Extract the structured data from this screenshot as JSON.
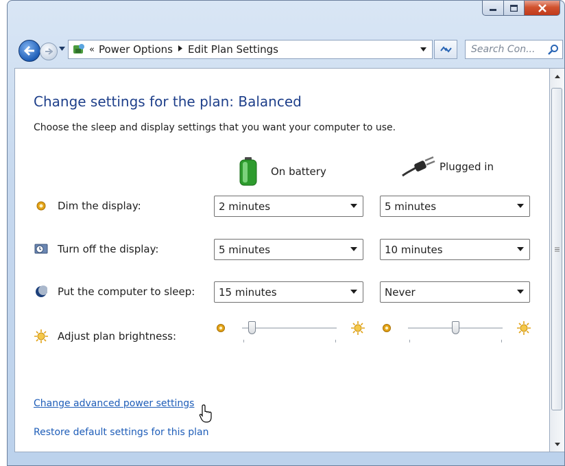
{
  "window": {
    "caption": {
      "minimize_icon": "minimize-icon",
      "maximize_icon": "maximize-icon",
      "close_icon": "close-icon"
    }
  },
  "nav": {
    "breadcrumb": {
      "chevron": "«",
      "items": [
        "Power Options",
        "Edit Plan Settings"
      ]
    },
    "search_placeholder": "Search Con..."
  },
  "page": {
    "title": "Change settings for the plan: Balanced",
    "subtitle": "Choose the sleep and display settings that you want your computer to use.",
    "columns": {
      "battery": "On battery",
      "plugged": "Plugged in"
    },
    "settings": [
      {
        "label": "Dim the display:",
        "battery": "2 minutes",
        "plugged": "5 minutes",
        "icon": "dim-display-icon"
      },
      {
        "label": "Turn off the display:",
        "battery": "5 minutes",
        "plugged": "10 minutes",
        "icon": "monitor-clock-icon"
      },
      {
        "label": "Put the computer to sleep:",
        "battery": "15 minutes",
        "plugged": "Never",
        "icon": "sleep-moon-icon"
      }
    ],
    "brightness": {
      "label": "Adjust plan brightness:",
      "battery_level": 0.1,
      "plugged_level": 0.5
    },
    "links": {
      "advanced": "Change advanced power settings",
      "restore": "Restore default settings for this plan"
    }
  },
  "colors": {
    "title": "#1e3f8a",
    "link": "#1e5db8",
    "battery_green": "#3cb93c"
  }
}
